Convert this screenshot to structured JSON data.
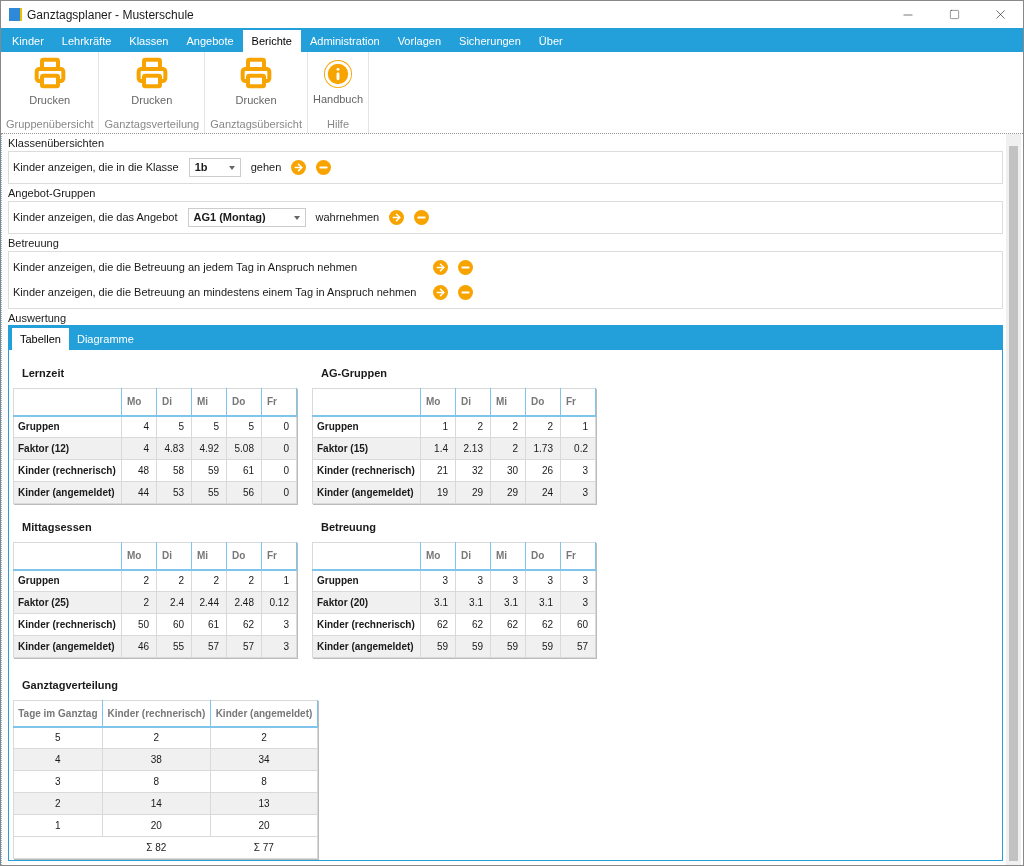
{
  "window": {
    "title": "Ganztagsplaner - Musterschule"
  },
  "menu": [
    {
      "label": "Kinder",
      "selected": false
    },
    {
      "label": "Lehrkräfte",
      "selected": false
    },
    {
      "label": "Klassen",
      "selected": false
    },
    {
      "label": "Angebote",
      "selected": false
    },
    {
      "label": "Berichte",
      "selected": true
    },
    {
      "label": "Administration",
      "selected": false
    },
    {
      "label": "Vorlagen",
      "selected": false
    },
    {
      "label": "Sicherungen",
      "selected": false
    },
    {
      "label": "Über",
      "selected": false
    }
  ],
  "ribbon": [
    {
      "kind": "printer",
      "button": "Drucken",
      "group": "Gruppenübersicht"
    },
    {
      "kind": "printer",
      "button": "Drucken",
      "group": "Ganztagsverteilung"
    },
    {
      "kind": "printer",
      "button": "Drucken",
      "group": "Ganztagsübersicht"
    },
    {
      "kind": "info",
      "button": "Handbuch",
      "group": "Hilfe"
    }
  ],
  "filters": [
    {
      "title": "Klassenübersichten",
      "rows": [
        {
          "kind": "select",
          "before": "Kinder anzeigen, die in die Klasse",
          "value": "1b",
          "after": "gehen"
        }
      ]
    },
    {
      "title": "Angebot-Gruppen",
      "rows": [
        {
          "kind": "select",
          "before": "Kinder anzeigen, die das Angebot",
          "value": "AG1 (Montag)",
          "after": "wahrnehmen"
        }
      ]
    },
    {
      "title": "Betreuung",
      "rows": [
        {
          "kind": "text",
          "before": "Kinder anzeigen, die die Betreuung an jedem Tag in Anspruch nehmen"
        },
        {
          "kind": "text",
          "before": "Kinder anzeigen, die die Betreuung an mindestens einem Tag in Anspruch nehmen"
        }
      ]
    }
  ],
  "evaluation": {
    "title": "Auswertung",
    "tabs": [
      {
        "label": "Tabellen",
        "selected": true
      },
      {
        "label": "Diagramme",
        "selected": false
      }
    ],
    "tables": [
      {
        "title": "Lernzeit",
        "columns": [
          "Mo",
          "Di",
          "Mi",
          "Do",
          "Fr"
        ],
        "rows": [
          {
            "label": "Gruppen",
            "values": [
              "4",
              "5",
              "5",
              "5",
              "0"
            ]
          },
          {
            "label": "Faktor (12)",
            "values": [
              "4",
              "4.83",
              "4.92",
              "5.08",
              "0"
            ]
          },
          {
            "label": "Kinder (rechnerisch)",
            "values": [
              "48",
              "58",
              "59",
              "61",
              "0"
            ]
          },
          {
            "label": "Kinder (angemeldet)",
            "values": [
              "44",
              "53",
              "55",
              "56",
              "0"
            ]
          }
        ]
      },
      {
        "title": "AG-Gruppen",
        "columns": [
          "Mo",
          "Di",
          "Mi",
          "Do",
          "Fr"
        ],
        "rows": [
          {
            "label": "Gruppen",
            "values": [
              "1",
              "2",
              "2",
              "2",
              "1"
            ]
          },
          {
            "label": "Faktor (15)",
            "values": [
              "1.4",
              "2.13",
              "2",
              "1.73",
              "0.2"
            ]
          },
          {
            "label": "Kinder (rechnerisch)",
            "values": [
              "21",
              "32",
              "30",
              "26",
              "3"
            ]
          },
          {
            "label": "Kinder (angemeldet)",
            "values": [
              "19",
              "29",
              "29",
              "24",
              "3"
            ]
          }
        ]
      },
      {
        "title": "Mittagsessen",
        "columns": [
          "Mo",
          "Di",
          "Mi",
          "Do",
          "Fr"
        ],
        "rows": [
          {
            "label": "Gruppen",
            "values": [
              "2",
              "2",
              "2",
              "2",
              "1"
            ]
          },
          {
            "label": "Faktor (25)",
            "values": [
              "2",
              "2.4",
              "2.44",
              "2.48",
              "0.12"
            ]
          },
          {
            "label": "Kinder (rechnerisch)",
            "values": [
              "50",
              "60",
              "61",
              "62",
              "3"
            ]
          },
          {
            "label": "Kinder (angemeldet)",
            "values": [
              "46",
              "55",
              "57",
              "57",
              "3"
            ]
          }
        ]
      },
      {
        "title": "Betreuung",
        "columns": [
          "Mo",
          "Di",
          "Mi",
          "Do",
          "Fr"
        ],
        "rows": [
          {
            "label": "Gruppen",
            "values": [
              "3",
              "3",
              "3",
              "3",
              "3"
            ]
          },
          {
            "label": "Faktor (20)",
            "values": [
              "3.1",
              "3.1",
              "3.1",
              "3.1",
              "3"
            ]
          },
          {
            "label": "Kinder (rechnerisch)",
            "values": [
              "62",
              "62",
              "62",
              "62",
              "60"
            ]
          },
          {
            "label": "Kinder (angemeldet)",
            "values": [
              "59",
              "59",
              "59",
              "59",
              "57"
            ]
          }
        ]
      }
    ],
    "distribution": {
      "title": "Ganztagverteilung",
      "columns": [
        "Tage im Ganztag",
        "Kinder (rechnerisch)",
        "Kinder (angemeldet)"
      ],
      "rows": [
        [
          "5",
          "2",
          "2"
        ],
        [
          "4",
          "38",
          "34"
        ],
        [
          "3",
          "8",
          "8"
        ],
        [
          "2",
          "14",
          "13"
        ],
        [
          "1",
          "20",
          "20"
        ]
      ],
      "totals": [
        "Σ 82",
        "Σ 77"
      ]
    }
  }
}
